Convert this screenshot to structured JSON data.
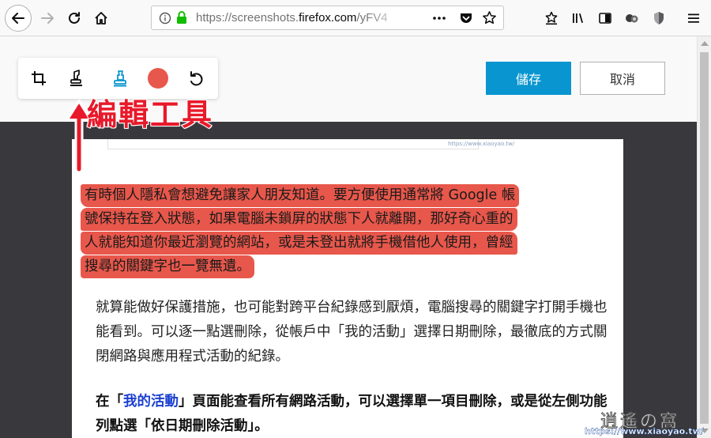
{
  "browser": {
    "url_prefix": "https://screenshots.",
    "url_domain": "firefox.com",
    "url_path": "/yFV4"
  },
  "editor": {
    "tools": [
      {
        "name": "crop-icon"
      },
      {
        "name": "highlighter-icon"
      },
      {
        "name": "pen-icon"
      },
      {
        "name": "color-picker"
      },
      {
        "name": "undo-icon"
      }
    ],
    "selected_color": "#e8574b",
    "save_label": "儲存",
    "cancel_label": "取消"
  },
  "annotation": {
    "label": "編輯工具",
    "color": "#e8192a"
  },
  "content": {
    "preview_url": "https://www.xiaoyao.tw/",
    "highlighted_lines": [
      "有時個人隱私會想避免讓家人朋友知道。要方便使用通常將 Google 帳",
      "號保持在登入狀態，如果電腦未鎖屏的狀態下人就離開，那好奇心重的",
      "人就能知道你最近瀏覽的網站，或是未登出就將手機借他人使用，曾經",
      "搜尋的關鍵字也一覽無遺。"
    ],
    "paragraph2": "就算能做好保護措施，也可能對跨平台紀錄感到厭煩，電腦搜尋的關鍵字打開手機也能看到。可以逐一點選刪除，從帳戶中「我的活動」選擇日期刪除，最徹底的方式關閉網路與應用程式活動的紀錄。",
    "paragraph3_before": "在「",
    "paragraph3_link": "我的活動",
    "paragraph3_after": "」頁面能查看所有網路活動，可以選擇單一項目刪除，或是從左側功能列點選「依日期刪除活動」。"
  },
  "watermark": {
    "logo": "逍遙の窩",
    "url": "https://www.xiaoyao.tw/"
  }
}
